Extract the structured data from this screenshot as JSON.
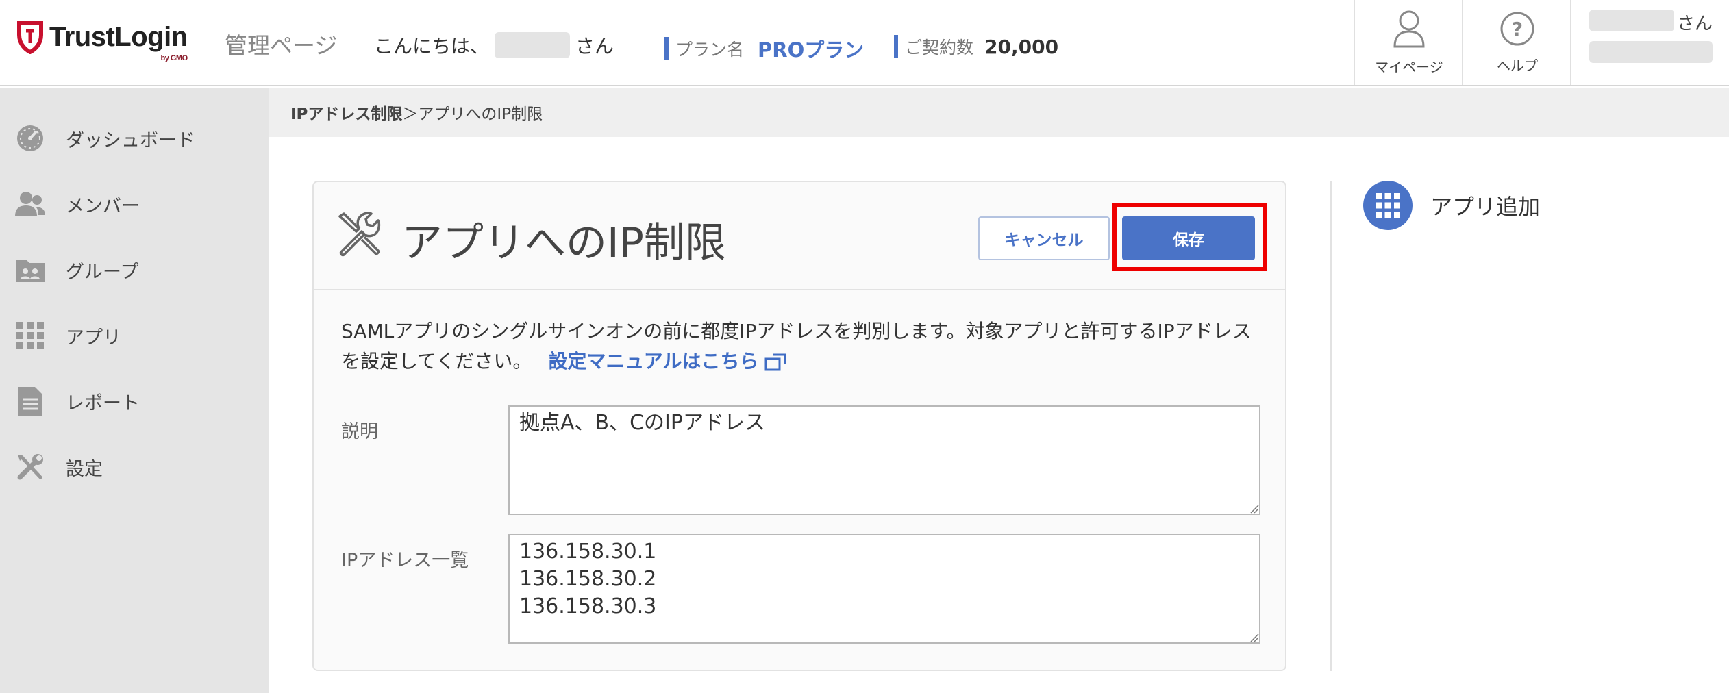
{
  "header": {
    "logo_text": "TrustLogin",
    "logo_sub": "by GMO",
    "admin_label": "管理ページ",
    "greeting_prefix": "こんにちは、",
    "greeting_suffix": "さん",
    "plan_label": "プラン名",
    "plan_value": "PROプラン",
    "contract_label": "ご契約数",
    "contract_value": "20,000",
    "mypage_label": "マイページ",
    "help_label": "ヘルプ",
    "user_suffix": "さん"
  },
  "sidebar": {
    "items": [
      {
        "label": "ダッシュボード",
        "icon": "dashboard-icon"
      },
      {
        "label": "メンバー",
        "icon": "members-icon"
      },
      {
        "label": "グループ",
        "icon": "group-icon"
      },
      {
        "label": "アプリ",
        "icon": "apps-grid-icon"
      },
      {
        "label": "レポート",
        "icon": "report-icon"
      },
      {
        "label": "設定",
        "icon": "settings-tools-icon"
      }
    ]
  },
  "breadcrumb": {
    "parent": "IPアドレス制限",
    "separator": " ＞",
    "current": "アプリへのIP制限"
  },
  "card": {
    "title": "アプリへのIP制限",
    "cancel_label": "キャンセル",
    "save_label": "保存",
    "description": "SAMLアプリのシングルサインオンの前に都度IPアドレスを判別します。対象アプリと許可するIPアドレスを設定してください。",
    "manual_link": "設定マニュアルはこちら",
    "fields": {
      "description_label": "説明",
      "description_value": "拠点A、B、CのIPアドレス",
      "ip_label": "IPアドレス一覧",
      "ip_value": "136.158.30.1\n136.158.30.2\n136.158.30.3"
    }
  },
  "right_panel": {
    "add_app_label": "アプリ追加"
  },
  "colors": {
    "accent": "#4a73c7",
    "highlight": "#ee0000",
    "logo_red": "#c8102e"
  }
}
